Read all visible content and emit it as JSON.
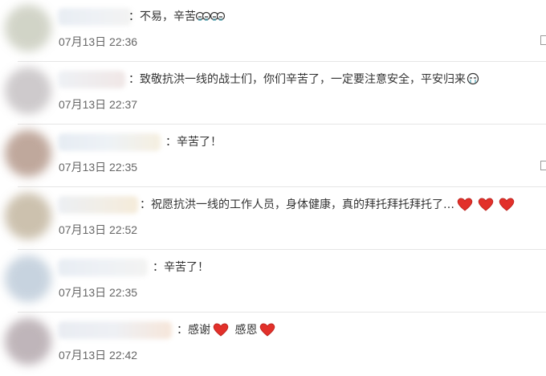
{
  "comments": [
    {
      "separator": "：",
      "text": "不易，辛苦",
      "time": "07月13日 22:36",
      "avatar_color": "#cdd0c2"
    },
    {
      "separator": "：",
      "text": "致敬抗洪一线的战士们，你们辛苦了，一定要注意安全，平安归来",
      "time": "07月13日 22:37",
      "avatar_color": "#c9c5c7"
    },
    {
      "separator": "：",
      "text": "辛苦了！",
      "time": "07月13日 22:35",
      "avatar_color": "#b99f92"
    },
    {
      "separator": "：",
      "text": "祝愿抗洪一线的工作人员，身体健康，真的拜托拜托拜托了…",
      "time": "07月13日 22:52",
      "avatar_color": "#c7bba6"
    },
    {
      "separator": "：",
      "text": "辛苦了！",
      "time": "07月13日 22:35",
      "avatar_color": "#c2cfdc"
    },
    {
      "separator": "：",
      "text_a": "感谢",
      "text_b": "感恩",
      "time": "07月13日 22:42",
      "avatar_color": "#b9aeb3"
    }
  ],
  "icons": {
    "cry": "crying-face-icon",
    "heart": "red-heart-icon",
    "reply": "reply-icon"
  },
  "colors": {
    "heart": "#e2302a",
    "time": "#666666",
    "text": "#333333"
  }
}
